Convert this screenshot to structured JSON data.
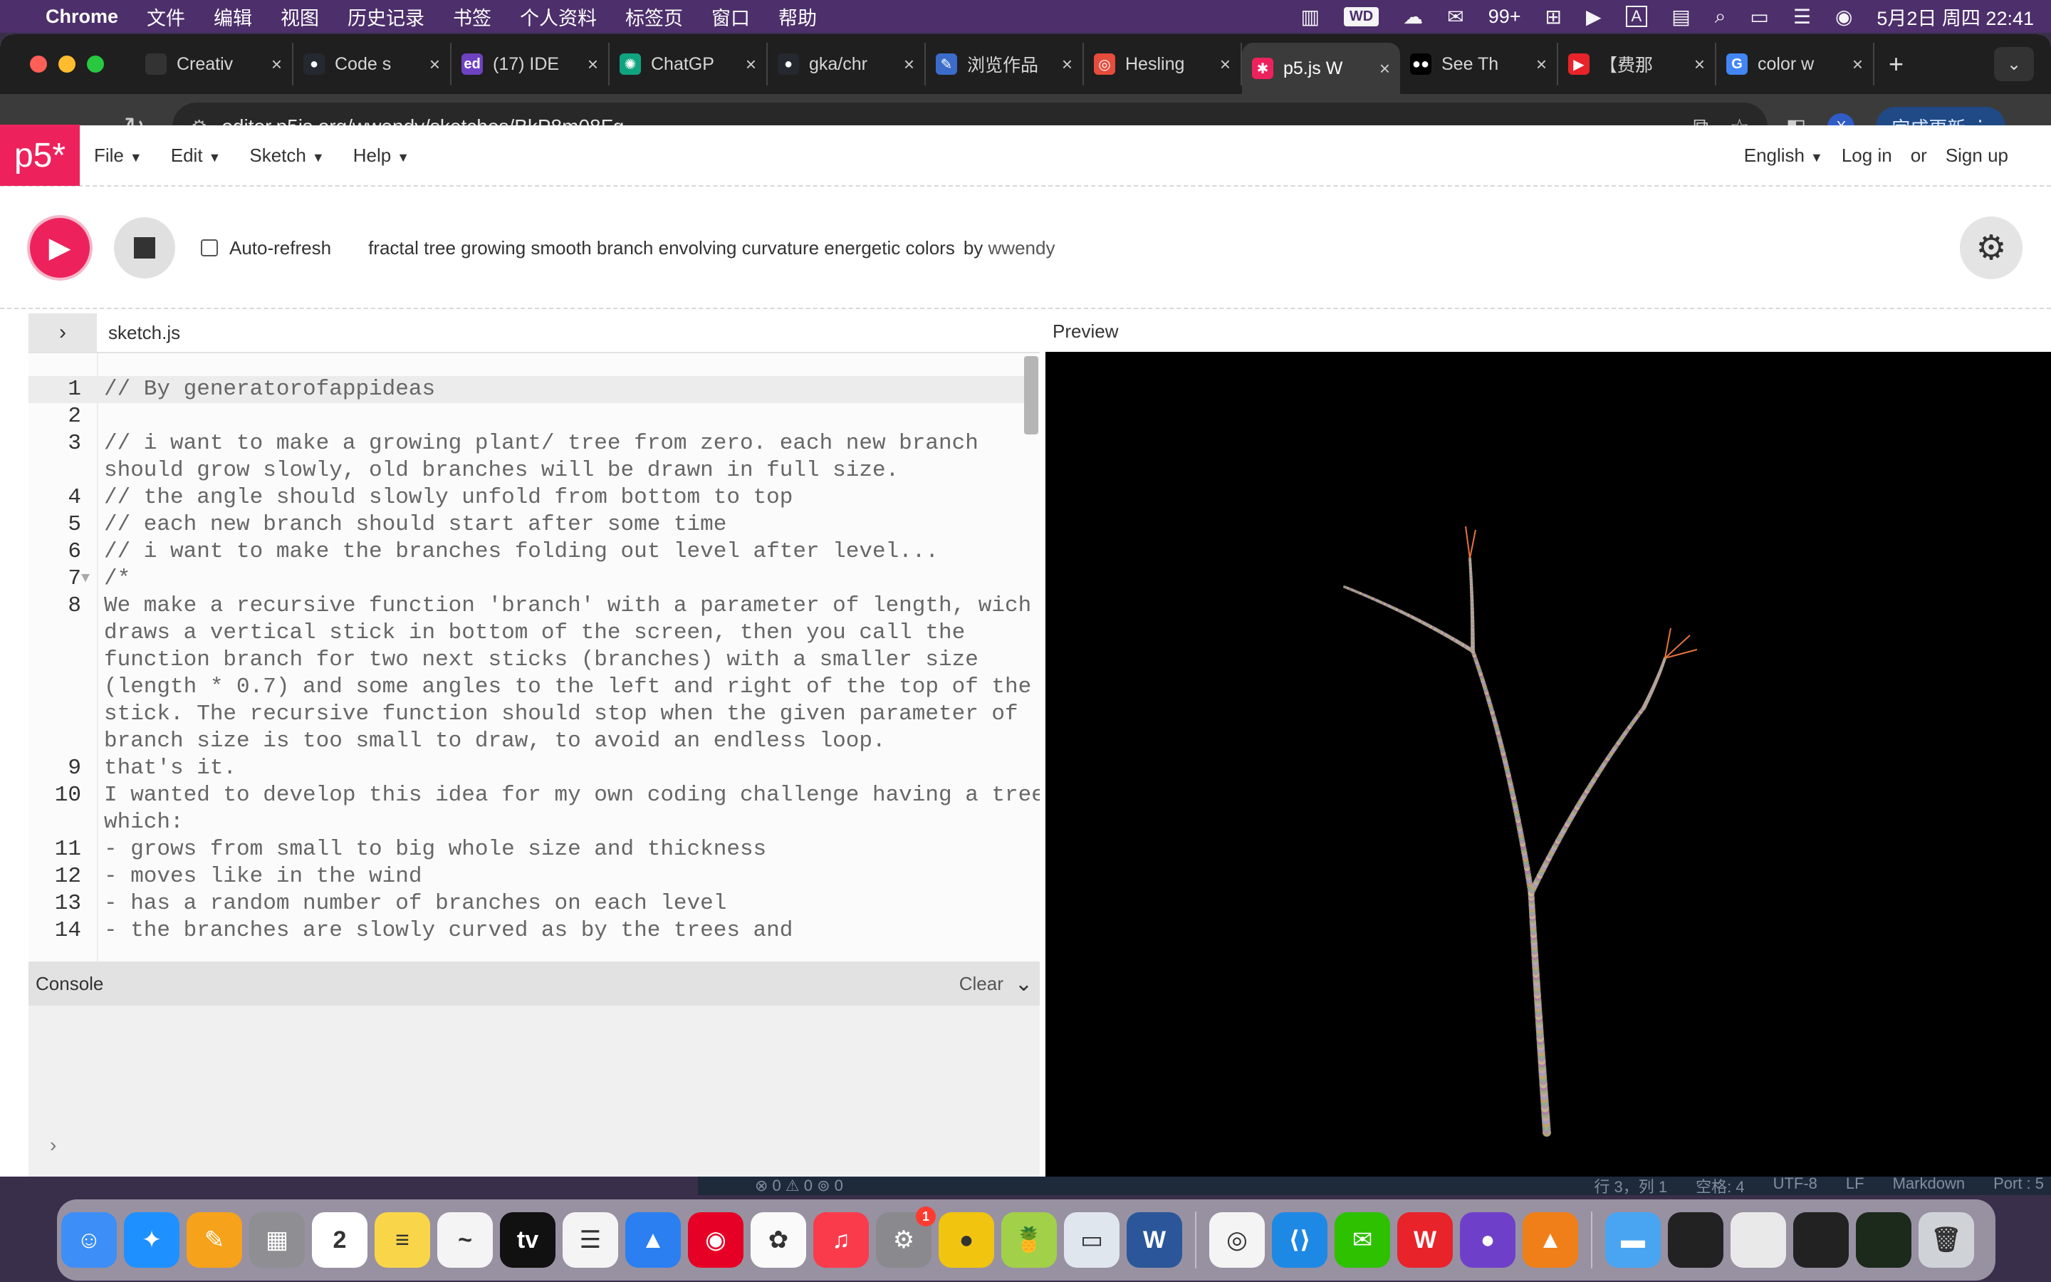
{
  "menubar": {
    "app": "Chrome",
    "items": [
      "文件",
      "编辑",
      "视图",
      "历史记录",
      "书签",
      "个人资料",
      "标签页",
      "窗口",
      "帮助"
    ],
    "wechat_count": "99+",
    "datetime": "5月2日 周四  22:41"
  },
  "tabs": [
    {
      "title": "Creativ",
      "color": "#333333",
      "glyph": ""
    },
    {
      "title": "Code s",
      "color": "#24292f",
      "glyph": "●"
    },
    {
      "title": "(17) IDE",
      "color": "#6f42c1",
      "glyph": "ed"
    },
    {
      "title": "ChatGP",
      "color": "#10a37f",
      "glyph": "✺"
    },
    {
      "title": "gka/chr",
      "color": "#24292f",
      "glyph": "●"
    },
    {
      "title": "浏览作品",
      "color": "#3b6cc9",
      "glyph": "✎"
    },
    {
      "title": "Hesling",
      "color": "#e74c3c",
      "glyph": "◎"
    },
    {
      "title": "p5.js W",
      "color": "#ed225d",
      "glyph": "✱"
    },
    {
      "title": "See Th",
      "color": "#000000",
      "glyph": "●●"
    },
    {
      "title": "【费那",
      "color": "#e8232a",
      "glyph": "▶"
    },
    {
      "title": "color w",
      "color": "#4285f4",
      "glyph": "G"
    }
  ],
  "active_tab_index": 7,
  "address": {
    "url": "editor.p5js.org/wwendy/sketches/BkP8m08Fg",
    "update_label": "完成更新",
    "profile_initial": "X"
  },
  "p5": {
    "logo": "p5*",
    "menu": [
      "File",
      "Edit",
      "Sketch",
      "Help"
    ],
    "language": "English",
    "login": "Log in",
    "or": "or",
    "signup": "Sign up",
    "autorefresh": "Auto-refresh",
    "sketch_title": "fractal tree growing smooth branch envolving curvature energetic colors",
    "by": "by",
    "author": "wwendy",
    "filename": "sketch.js",
    "preview_label": "Preview",
    "console_label": "Console",
    "clear_label": "Clear"
  },
  "code_lines": [
    {
      "num": "1",
      "text": "// By generatorofappideas",
      "hl": true
    },
    {
      "num": "2",
      "text": ""
    },
    {
      "num": "3",
      "text": "// i want to make a growing plant/ tree from zero. each new branch"
    },
    {
      "num": "",
      "text": "should grow slowly, old branches will be drawn in full size."
    },
    {
      "num": "4",
      "text": "// the angle should slowly unfold from bottom to top"
    },
    {
      "num": "5",
      "text": "// each new branch should start after some time"
    },
    {
      "num": "6",
      "text": "// i want to make the branches folding out level after level..."
    },
    {
      "num": "7",
      "text": "/*",
      "fold": true
    },
    {
      "num": "8",
      "text": "We make a recursive function 'branch' with a parameter of length, wich"
    },
    {
      "num": "",
      "text": "draws a vertical stick in bottom of the screen, then you call the"
    },
    {
      "num": "",
      "text": "function branch for two next sticks (branches) with a smaller size"
    },
    {
      "num": "",
      "text": "(length * 0.7) and some angles to the left and right of the top of the"
    },
    {
      "num": "",
      "text": "stick. The recursive function should stop when the given parameter of"
    },
    {
      "num": "",
      "text": "branch size is too small to draw, to avoid an endless loop."
    },
    {
      "num": "9",
      "text": "that's it."
    },
    {
      "num": "10",
      "text": "I wanted to develop this idea for my own coding challenge having a tree"
    },
    {
      "num": "",
      "text": "which:"
    },
    {
      "num": "11",
      "text": "- grows from small to big whole size and thickness"
    },
    {
      "num": "12",
      "text": "- moves like in the wind"
    },
    {
      "num": "13",
      "text": "- has a random number of branches on each level"
    },
    {
      "num": "14",
      "text": "- the branches are slowly curved as by the trees and"
    }
  ],
  "vscode_status": {
    "left": "⊗ 0 ⚠ 0    ⊚ 0",
    "position": "行 3，列 1",
    "spaces": "空格: 4",
    "encoding": "UTF-8",
    "eol": "LF",
    "lang": "Markdown",
    "port": "Port : 5"
  },
  "dock": [
    {
      "name": "finder",
      "color": "#3d8ef7",
      "glyph": "☺"
    },
    {
      "name": "safari",
      "color": "#1e90ff",
      "glyph": "✦"
    },
    {
      "name": "pages",
      "color": "#f7a21b",
      "glyph": "✎"
    },
    {
      "name": "launchpad",
      "color": "#8e8e93",
      "glyph": "▦"
    },
    {
      "name": "calendar",
      "color": "#ffffff",
      "glyph": "2"
    },
    {
      "name": "notes",
      "color": "#f9d54a",
      "glyph": "≡"
    },
    {
      "name": "freeform",
      "color": "#f4f4f4",
      "glyph": "~"
    },
    {
      "name": "apple-tv",
      "color": "#111111",
      "glyph": "tv"
    },
    {
      "name": "reminders",
      "color": "#f4f4f4",
      "glyph": "☰"
    },
    {
      "name": "keynote",
      "color": "#2b7ff0",
      "glyph": "▲"
    },
    {
      "name": "netease-music",
      "color": "#e60026",
      "glyph": "◉"
    },
    {
      "name": "photos",
      "color": "#fafafa",
      "glyph": "✿"
    },
    {
      "name": "music",
      "color": "#fa3b4c",
      "glyph": "♫"
    },
    {
      "name": "system-settings",
      "color": "#8a8a8e",
      "glyph": "⚙",
      "badge": "1"
    },
    {
      "name": "ball-app",
      "color": "#f1c40f",
      "glyph": "●"
    },
    {
      "name": "fruit-app",
      "color": "#a2d149",
      "glyph": "🍍"
    },
    {
      "name": "preview-app",
      "color": "#dfe6ee",
      "glyph": "▭"
    },
    {
      "name": "word",
      "color": "#2b579a",
      "glyph": "W"
    },
    {
      "sep": true
    },
    {
      "name": "chrome",
      "color": "#f4f4f4",
      "glyph": "◎"
    },
    {
      "name": "vscode",
      "color": "#1e88e5",
      "glyph": "⟨⟩"
    },
    {
      "name": "wechat",
      "color": "#2dc100",
      "glyph": "✉"
    },
    {
      "name": "wps",
      "color": "#e8232a",
      "glyph": "W"
    },
    {
      "name": "github-desktop",
      "color": "#6e40c9",
      "glyph": "●"
    },
    {
      "name": "matlab",
      "color": "#f07f1a",
      "glyph": "▲"
    },
    {
      "sep": true
    },
    {
      "name": "folder",
      "color": "#49a5f2",
      "glyph": "▬"
    },
    {
      "name": "window-thumb-1",
      "color": "#222222",
      "glyph": ""
    },
    {
      "name": "window-thumb-2",
      "color": "#e9e9e9",
      "glyph": ""
    },
    {
      "name": "window-thumb-3",
      "color": "#222222",
      "glyph": ""
    },
    {
      "name": "window-thumb-4",
      "color": "#1b2a1b",
      "glyph": ""
    },
    {
      "name": "trash",
      "color": "#cfd3d8",
      "glyph": "🗑"
    }
  ]
}
